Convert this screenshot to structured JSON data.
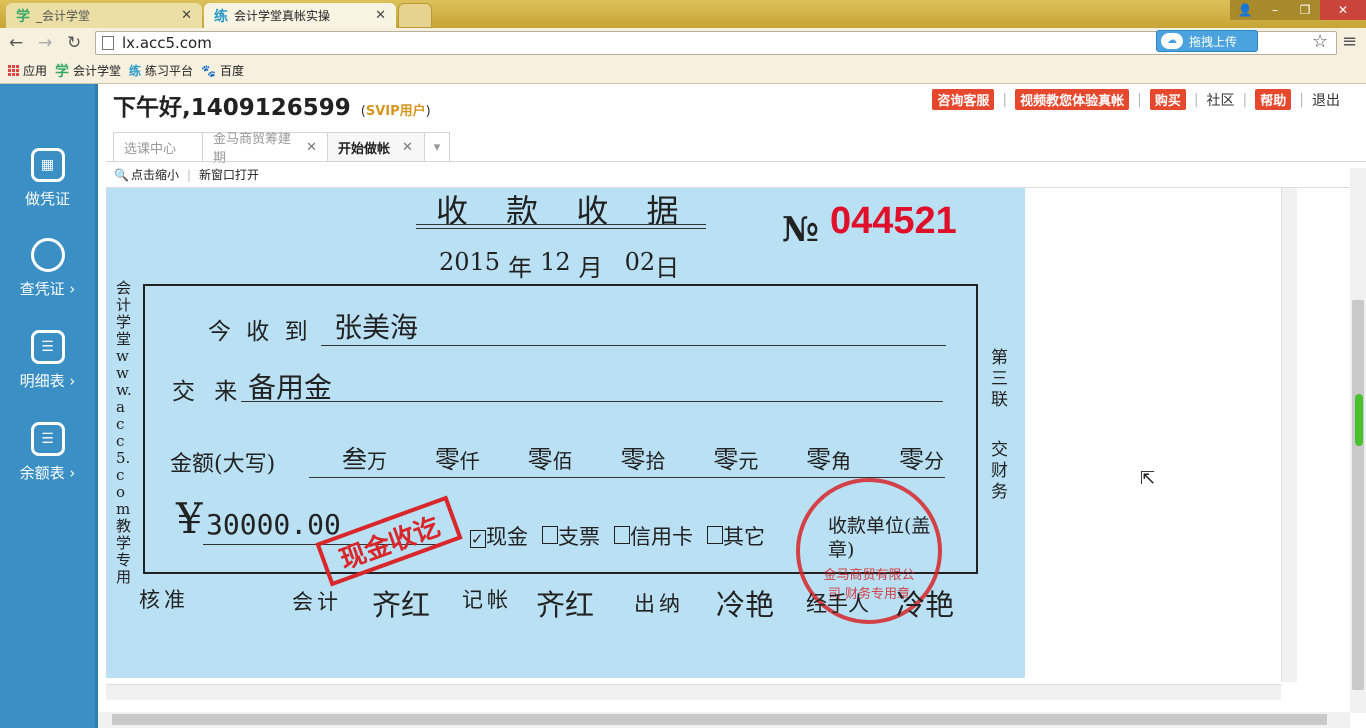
{
  "browser": {
    "tabs": [
      {
        "icon": "学",
        "label": "_会计学堂"
      },
      {
        "icon": "练",
        "label": "会计学堂真帐实操"
      }
    ],
    "url": "lx.acc5.com",
    "upload_label": "拖拽上传",
    "bookmarks": [
      {
        "label": "应用"
      },
      {
        "icon": "学",
        "label": "会计学堂"
      },
      {
        "icon": "练",
        "label": "练习平台"
      },
      {
        "label": "百度"
      }
    ]
  },
  "sidebar": {
    "items": [
      {
        "label": "做凭证"
      },
      {
        "label": "查凭证 ›"
      },
      {
        "label": "明细表 ›"
      },
      {
        "label": "余额表 ›"
      }
    ]
  },
  "header": {
    "greeting": "下午好,1409126599",
    "vip_open": "(",
    "vip": "SVIP用户",
    "vip_close": ")",
    "links": {
      "consult": "咨询客服",
      "video": "视频教您体验真帐",
      "buy": "购买",
      "community": "社区",
      "help": "帮助",
      "logout": "退出"
    }
  },
  "content_tabs": [
    {
      "label": "选课中心"
    },
    {
      "label": "金马商贸筹建期"
    },
    {
      "label": "开始做帐"
    }
  ],
  "toolbar": {
    "zoom_out": "点击缩小",
    "new_window": "新窗口打开"
  },
  "receipt": {
    "title": "收 款 收 据",
    "no_label": "№",
    "no": "044521",
    "date": {
      "year": "2015",
      "month": "12",
      "day": "02",
      "y_char": "年",
      "m_char": "月",
      "d_char": "日"
    },
    "side_left": "会计学堂www.acc5.com教学专用",
    "received_from_label": "今 收 到",
    "received_from": "张美海",
    "for_label": "交 来",
    "for": "备用金",
    "amount_words_label": "金额(大写)",
    "amount_words": [
      {
        "digit": "叁",
        "unit": "万"
      },
      {
        "digit": "零",
        "unit": "仟"
      },
      {
        "digit": "零",
        "unit": "佰"
      },
      {
        "digit": "零",
        "unit": "拾"
      },
      {
        "digit": "零",
        "unit": "元"
      },
      {
        "digit": "零",
        "unit": "角"
      },
      {
        "digit": "零",
        "unit": "分"
      }
    ],
    "currency": "¥",
    "amount": "30000.00",
    "stamp_cash": "现金收讫",
    "payment_options": [
      "现金",
      "支票",
      "信用卡",
      "其它"
    ],
    "payment_checked": "现金",
    "payee_unit": "收款单位(盖章)",
    "company_seal": "金马商贸有限公司 财务专用章",
    "side_right_1": "第三联",
    "side_right_2": "交财务",
    "sign": {
      "approve_label": "核准",
      "accountant_label": "会计",
      "accountant": "齐红",
      "book_label": "记帐",
      "book": "齐红",
      "cashier_label": "出纳",
      "cashier": "冷艳",
      "handler_label": "经手人",
      "handler": "冷艳"
    }
  },
  "colors": {
    "sidebar": "#3a8fc4",
    "receipt_bg": "#b9e0f3",
    "accent_red": "#e6482d",
    "seal_red": "#d8262a"
  }
}
